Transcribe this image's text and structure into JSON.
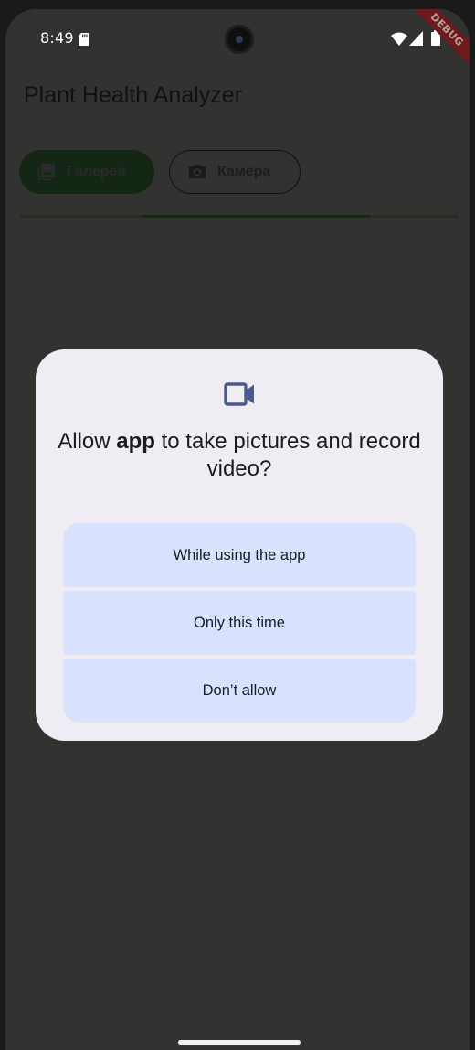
{
  "status_bar": {
    "time": "8:49",
    "debug_label": "DEBUG",
    "icons": [
      "sd-card-icon",
      "wifi-icon",
      "signal-icon",
      "battery-icon"
    ]
  },
  "app_bar": {
    "title": "Plant Health Analyzer"
  },
  "source_selector": {
    "gallery_label": "Галерея",
    "gallery_icon": "image-icon",
    "camera_label": "Камера",
    "camera_icon": "camera-icon",
    "selected": "gallery"
  },
  "progress": {
    "indeterminate": true,
    "visible_segment_start": 0.28,
    "visible_segment_end": 0.8
  },
  "permission_dialog": {
    "icon": "videocam-icon",
    "title_prefix": "Allow ",
    "title_app": "app",
    "title_suffix": " to take pictures and record video?",
    "buttons": {
      "while_using": "While using the app",
      "only_this_time": "Only this time",
      "dont_allow": "Don’t allow"
    }
  },
  "colors": {
    "scrim_background": "#323231",
    "dialog_surface": "#efecf3",
    "dialog_button": "#d8e2fd",
    "icon_accent": "#4a5a8e",
    "gallery_fill": "#142614",
    "progress_fill": "#0e2e0e"
  }
}
